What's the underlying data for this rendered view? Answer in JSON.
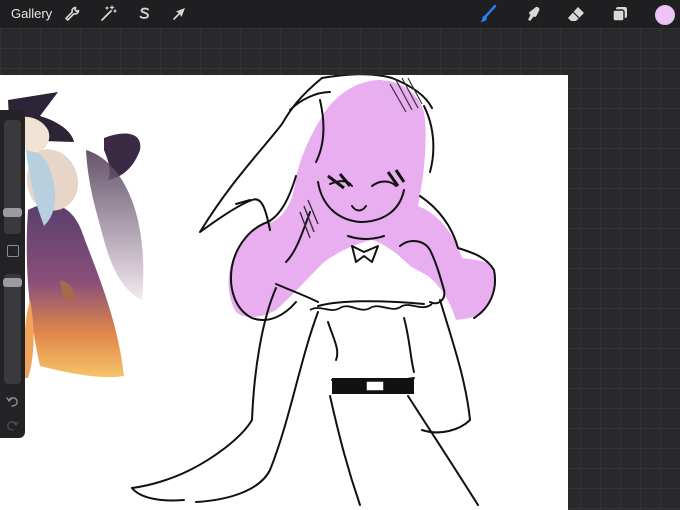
{
  "toolbar": {
    "gallery_label": "Gallery",
    "icons": {
      "actions": "wrench-icon",
      "adjustments": "magic-wand-icon",
      "selection": "selection-s-icon",
      "transform": "arrow-cursor-icon",
      "brush": "brush-icon",
      "smudge": "smudge-icon",
      "eraser": "eraser-icon",
      "layers": "layers-icon"
    },
    "active_color": "#efc3f5",
    "active_tool_color": "#2a7fff"
  },
  "sidebar": {
    "brush_size": 0.28,
    "brush_opacity": 0.03,
    "icons": {
      "undo": "undo-icon",
      "redo": "redo-icon",
      "modify": "square-icon"
    }
  },
  "canvas": {
    "hair_color": "#e8aef0",
    "line_color": "#111111"
  }
}
